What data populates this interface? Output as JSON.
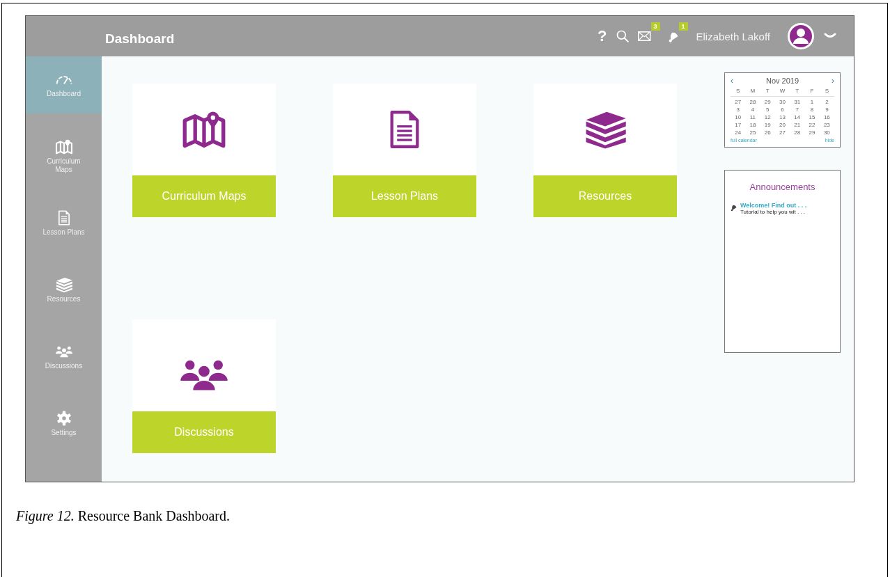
{
  "header": {
    "title": "Dashboard",
    "help": "?",
    "mail_badge": "3",
    "alerts_badge": "1",
    "user_name": "Elizabeth Lakoff"
  },
  "sidebar": {
    "items": [
      {
        "label": "Dashboard",
        "selected": true
      },
      {
        "label": "Curriculum Maps",
        "selected": false
      },
      {
        "label": "Lesson Plans",
        "selected": false
      },
      {
        "label": "Resources",
        "selected": false
      },
      {
        "label": "Discussions",
        "selected": false
      },
      {
        "label": "Settings",
        "selected": false
      }
    ]
  },
  "tiles": [
    {
      "label": "Curriculum Maps"
    },
    {
      "label": "Lesson Plans"
    },
    {
      "label": "Resources"
    },
    {
      "label": "Discussions"
    }
  ],
  "calendar": {
    "prev": "‹",
    "month": "Nov 2019",
    "next": "›",
    "weekdays": [
      "S",
      "M",
      "T",
      "W",
      "T",
      "F",
      "S"
    ],
    "weeks": [
      [
        "27",
        "28",
        "29",
        "30",
        "31",
        "1",
        "2"
      ],
      [
        "3",
        "4",
        "5",
        "6",
        "7",
        "8",
        "9"
      ],
      [
        "10",
        "11",
        "12",
        "13",
        "14",
        "15",
        "16"
      ],
      [
        "17",
        "18",
        "19",
        "20",
        "21",
        "22",
        "23"
      ],
      [
        "24",
        "25",
        "26",
        "27",
        "28",
        "29",
        "30"
      ]
    ],
    "full_link": "full calendar",
    "hide_link": "hide"
  },
  "announcements": {
    "title": "Announcements",
    "items": [
      {
        "title": "Welcome! Find out . . .",
        "text": "Tutorial to help you wit . . ."
      }
    ]
  },
  "caption": "*Figure 12.* Resource Bank Dashboard."
}
